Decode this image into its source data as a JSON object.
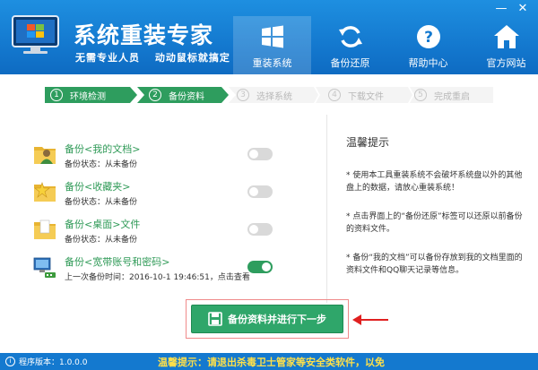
{
  "app": {
    "title": "系统重装专家",
    "slogans": [
      "无需专业人员",
      "动动鼠标就搞定"
    ]
  },
  "window_controls": {
    "minimize": "—",
    "close": "✕"
  },
  "nav": [
    {
      "label": "重装系统",
      "icon": "windows-icon",
      "active": true
    },
    {
      "label": "备份还原",
      "icon": "refresh-icon",
      "active": false
    },
    {
      "label": "帮助中心",
      "icon": "help-icon",
      "active": false
    },
    {
      "label": "官方网站",
      "icon": "home-icon",
      "active": false
    }
  ],
  "steps": [
    {
      "num": "1",
      "label": "环境检测",
      "state": "done"
    },
    {
      "num": "2",
      "label": "备份资料",
      "state": "current"
    },
    {
      "num": "3",
      "label": "选择系统",
      "state": "todo"
    },
    {
      "num": "4",
      "label": "下载文件",
      "state": "todo"
    },
    {
      "num": "5",
      "label": "完成重启",
      "state": "todo"
    }
  ],
  "backups": [
    {
      "title": "备份<我的文档>",
      "status": "备份状态：从未备份",
      "icon": "user-folder-icon",
      "enabled": false
    },
    {
      "title": "备份<收藏夹>",
      "status": "备份状态：从未备份",
      "icon": "favorites-folder-icon",
      "enabled": false
    },
    {
      "title": "备份<桌面>文件",
      "status": "备份状态：从未备份",
      "icon": "desktop-folder-icon",
      "enabled": false
    },
    {
      "title": "备份<宽带账号和密码>",
      "status": "上一次备份时间：2016-10-1 19:46:51，点击查看",
      "icon": "network-icon",
      "enabled": true
    }
  ],
  "tips": {
    "title": "温馨提示",
    "items": [
      "* 使用本工具重装系统不会破坏系统盘以外的其他盘上的数据，请放心重装系统！",
      "* 点击界面上的“备份还原”标签可以还原以前备份的资料文件。",
      "* 备份“我的文档”可以备份存放到我的文档里面的资料文件和QQ聊天记录等信息。"
    ]
  },
  "main_button": {
    "label": "备份资料并进行下一步",
    "icon": "save-icon"
  },
  "footer": {
    "version": "程序版本：1.0.0.0",
    "notice": "温馨提示：请退出杀毒卫士管家等安全类软件，以免"
  },
  "colors": {
    "brand_blue": "#1479cf",
    "accent_green": "#2e9d5e",
    "notice_yellow": "#ffe04a"
  }
}
